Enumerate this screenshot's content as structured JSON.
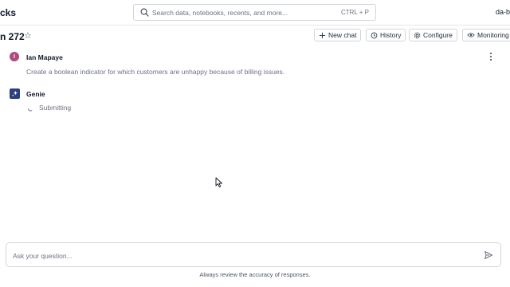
{
  "header": {
    "brand_fragment": "cks",
    "search_placeholder": "Search data, notebooks, recents, and more...",
    "search_shortcut": "CTRL + P",
    "workspace_fragment": "da-b"
  },
  "page": {
    "title_fragment": "n 272",
    "actions": [
      {
        "label": "New chat",
        "icon": "plus-icon"
      },
      {
        "label": "History",
        "icon": "history-icon"
      },
      {
        "label": "Configure",
        "icon": "gear-icon"
      },
      {
        "label": "Monitoring",
        "icon": "eye-icon"
      }
    ]
  },
  "conversation": {
    "user": {
      "avatar_letter": "I",
      "avatar_color": "#b04a7c",
      "name": "Ian Mapaye",
      "message": "Create a boolean indicator for which customers are unhappy because of billing issues."
    },
    "assistant": {
      "name": "Genie",
      "icon_color": "#2e3f7d",
      "status": "Submitting"
    }
  },
  "composer": {
    "placeholder": "Ask your question...",
    "disclaimer": "Always review the accuracy of responses."
  }
}
